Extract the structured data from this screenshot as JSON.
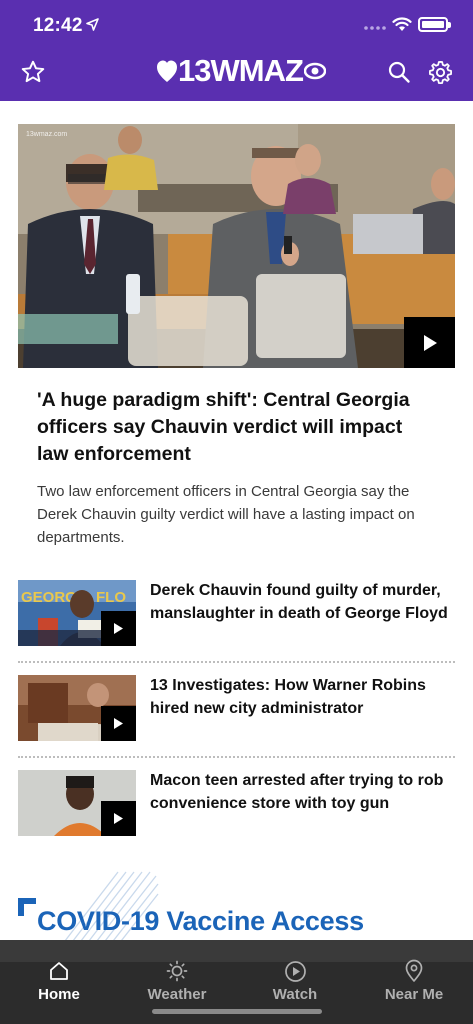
{
  "status_bar": {
    "time": "12:42"
  },
  "header": {
    "logo_text": "13WMAZ",
    "brand_color": "#5a2fb0",
    "left_icon": "star-icon",
    "right_icons": [
      "search-icon",
      "gear-icon"
    ]
  },
  "hero": {
    "image_watermark": "13wmaz.com",
    "title": "'A huge paradigm shift': Central Georgia officers say Chauvin verdict will impact law enforcement",
    "summary": "Two law enforcement officers in Central Georgia say the Derek Chauvin guilty verdict will have a lasting impact on departments.",
    "has_video": true
  },
  "stories": [
    {
      "title": "Derek Chauvin found guilty of murder, manslaughter in death of George Floyd",
      "has_video": true
    },
    {
      "title": "13 Investigates: How Warner Robins hired new city administrator",
      "has_video": true
    },
    {
      "title": "Macon teen arrested after trying to rob convenience store with toy gun",
      "has_video": true
    }
  ],
  "covid_banner": {
    "title": "COVID-19 Vaccine Access",
    "color": "#1b64b8"
  },
  "tabbar": {
    "tabs": [
      {
        "label": "Home",
        "icon": "home-icon",
        "active": true
      },
      {
        "label": "Weather",
        "icon": "sun-icon",
        "active": false
      },
      {
        "label": "Watch",
        "icon": "play-circle-icon",
        "active": false
      },
      {
        "label": "Near Me",
        "icon": "location-pin-icon",
        "active": false
      }
    ]
  }
}
